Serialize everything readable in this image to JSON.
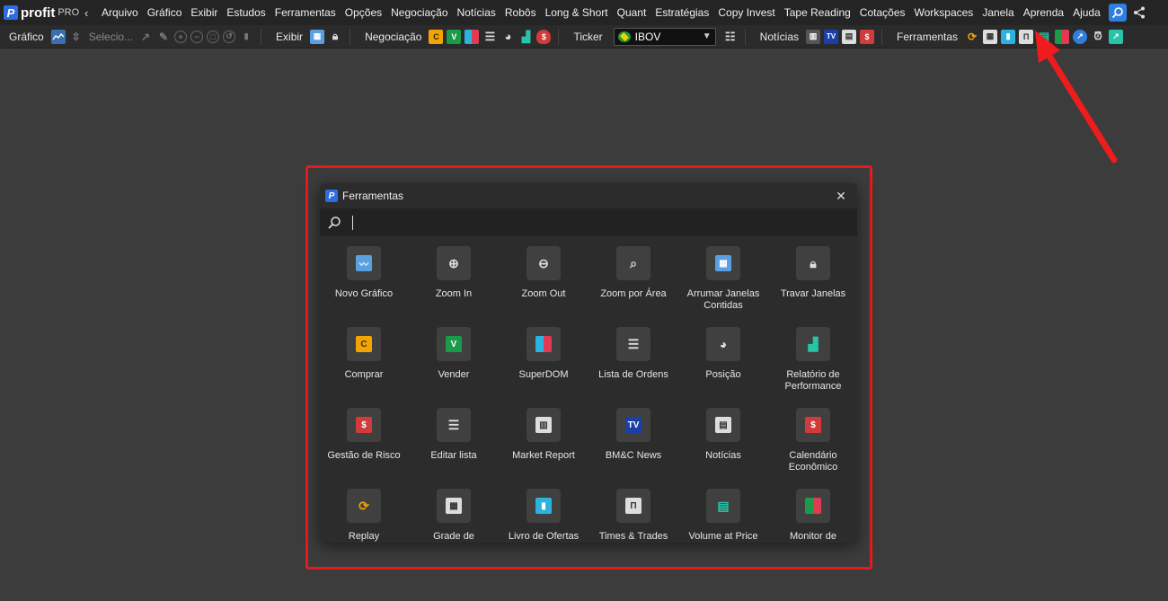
{
  "app": {
    "logo_letter": "P",
    "logo_text": "profit",
    "logo_suffix": "PRO"
  },
  "menu": {
    "items": [
      "Arquivo",
      "Gráfico",
      "Exibir",
      "Estudos",
      "Ferramentas",
      "Opções",
      "Negociação",
      "Notícias",
      "Robôs",
      "Long & Short",
      "Quant",
      "Estratégias",
      "Copy Invest",
      "Tape Reading",
      "Cotações",
      "Workspaces",
      "Janela",
      "Aprenda",
      "Ajuda"
    ]
  },
  "toolbar": {
    "grafico_label": "Gráfico",
    "select_text": "Selecio...",
    "exibir_label": "Exibir",
    "negociacao_label": "Negociação",
    "ticker_label": "Ticker",
    "ticker_value": "IBOV",
    "noticias_label": "Notícias",
    "ferramentas_label": "Ferramentas",
    "buy_letter": "C",
    "sell_letter": "V",
    "tv_letters": "TV"
  },
  "dialog": {
    "title": "Ferramentas",
    "search_value": "",
    "close_glyph": "✕",
    "tools": [
      {
        "label": "Novo Gráfico",
        "icon": "new-chart"
      },
      {
        "label": "Zoom In",
        "icon": "zoom-in"
      },
      {
        "label": "Zoom Out",
        "icon": "zoom-out"
      },
      {
        "label": "Zoom por Área",
        "icon": "zoom-area"
      },
      {
        "label": "Arrumar Janelas Contidas",
        "icon": "arrange-windows"
      },
      {
        "label": "Travar Janelas",
        "icon": "lock"
      },
      {
        "label": "Comprar",
        "icon": "buy"
      },
      {
        "label": "Vender",
        "icon": "sell"
      },
      {
        "label": "SuperDOM",
        "icon": "superdom"
      },
      {
        "label": "Lista de Ordens",
        "icon": "order-list"
      },
      {
        "label": "Posição",
        "icon": "position"
      },
      {
        "label": "Relatório de Performance",
        "icon": "performance"
      },
      {
        "label": "Gestão de Risco",
        "icon": "risk"
      },
      {
        "label": "Editar lista",
        "icon": "edit-list"
      },
      {
        "label": "Market Report",
        "icon": "market-report"
      },
      {
        "label": "BM&C News",
        "icon": "tv"
      },
      {
        "label": "Notícias",
        "icon": "news"
      },
      {
        "label": "Calendário Econômico",
        "icon": "calendar"
      },
      {
        "label": "Replay",
        "icon": "replay"
      },
      {
        "label": "Grade de",
        "icon": "grid"
      },
      {
        "label": "Livro de Ofertas",
        "icon": "book"
      },
      {
        "label": "Times & Trades",
        "icon": "times-trades"
      },
      {
        "label": "Volume at Price",
        "icon": "volume-price"
      },
      {
        "label": "Monitor de",
        "icon": "monitor"
      }
    ]
  },
  "colors": {
    "accent_blue": "#2f7fe0",
    "highlight_red": "#e31b1b",
    "buy_orange": "#f2a400",
    "sell_green": "#1b9a4a",
    "teal": "#27c4a8"
  }
}
